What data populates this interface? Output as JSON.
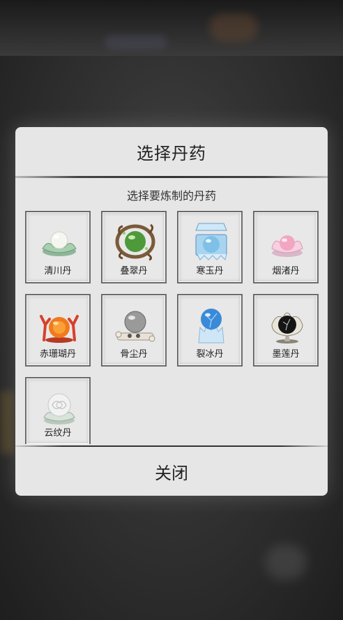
{
  "dialog": {
    "title": "选择丹药",
    "subtitle": "选择要炼制的丹药",
    "close_label": "关闭"
  },
  "pills": [
    {
      "name": "清川丹",
      "icon": "jade-lotus-pearl-icon",
      "color": "#f4f4ee"
    },
    {
      "name": "叠翠丹",
      "icon": "green-orb-nest-icon",
      "color": "#4e9a3a"
    },
    {
      "name": "寒玉丹",
      "icon": "ice-box-pearl-icon",
      "color": "#7fc0e8"
    },
    {
      "name": "烟渚丹",
      "icon": "pink-lotus-pearl-icon",
      "color": "#f2a6c2"
    },
    {
      "name": "赤珊瑚丹",
      "icon": "coral-fire-orb-icon",
      "color": "#f07a1e"
    },
    {
      "name": "骨尘丹",
      "icon": "bone-gray-orb-icon",
      "color": "#9a9a9a"
    },
    {
      "name": "裂冰丹",
      "icon": "ice-crystal-orb-icon",
      "color": "#3a8ad8"
    },
    {
      "name": "墨莲丹",
      "icon": "black-lotus-orb-icon",
      "color": "#151515"
    },
    {
      "name": "云纹丹",
      "icon": "cloud-pattern-pearl-icon",
      "color": "#f2f2f2"
    }
  ]
}
